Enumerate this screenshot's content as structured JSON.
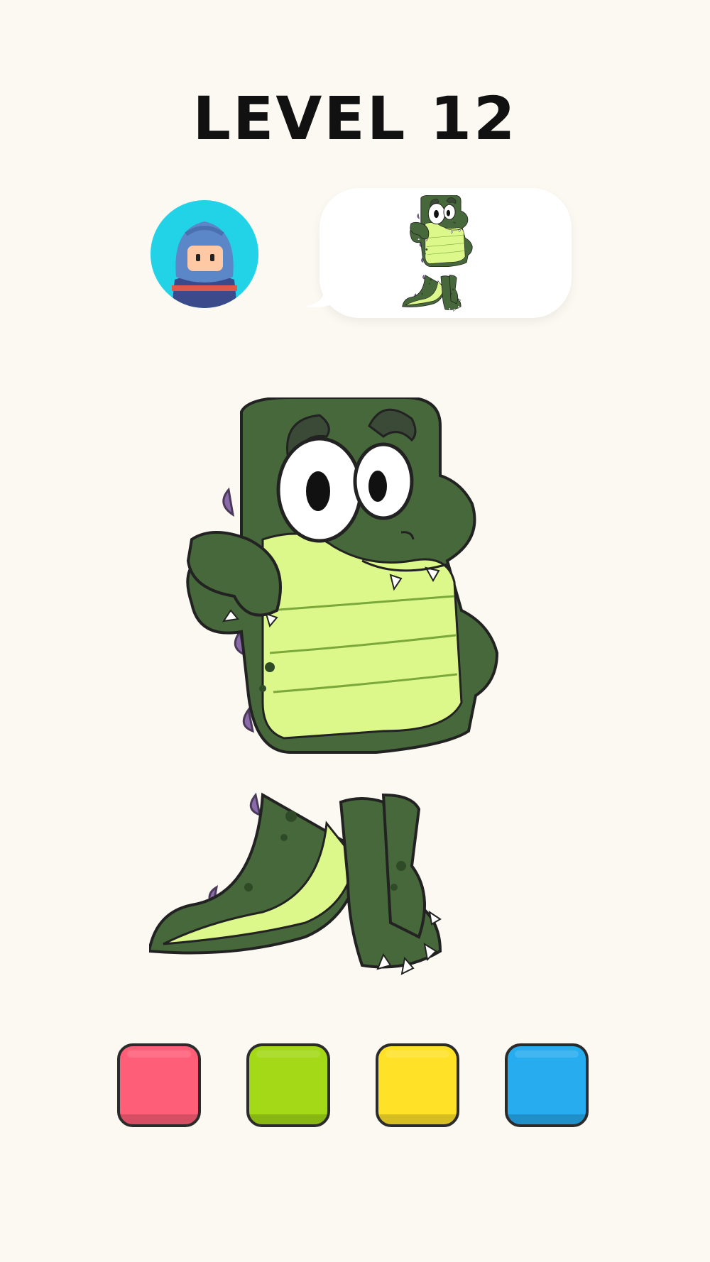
{
  "level": {
    "title": "LEVEL 12"
  },
  "avatar": {
    "icon": "ninja-avatar-icon",
    "background": "#22d3e8"
  },
  "speech_bubble": {
    "icon": "crocodile-target-icon"
  },
  "drawing": {
    "icon": "crocodile-drawing",
    "colors": {
      "skin": "#47683a",
      "belly": "#ddf88a",
      "spikes": "#8a6aa8"
    }
  },
  "palette": {
    "swatches": [
      {
        "name": "pink",
        "color": "#ff5e78"
      },
      {
        "name": "green",
        "color": "#a3d916"
      },
      {
        "name": "yellow",
        "color": "#ffe228"
      },
      {
        "name": "blue",
        "color": "#28acf0"
      }
    ]
  }
}
